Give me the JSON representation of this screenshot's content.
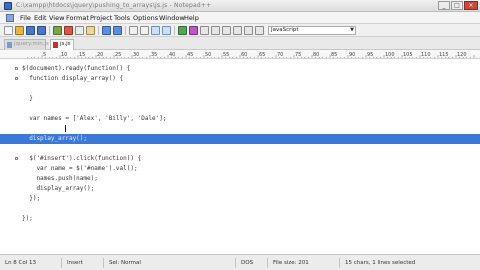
{
  "window": {
    "title": "C:\\xampp\\htdocs\\jquery\\pushing_to_arrays\\js.js - Notepad++"
  },
  "menu": {
    "items": [
      "File",
      "Edit",
      "View",
      "Format",
      "Project",
      "Tools",
      "Options",
      "Window",
      "Help"
    ]
  },
  "toolbar": {
    "language": "JavaScript"
  },
  "tabs": [
    {
      "label": "jquery.min.js",
      "active": false
    },
    {
      "label": "js.js",
      "active": true
    }
  ],
  "ruler": {
    "numbers": [
      "5",
      "10",
      "15",
      "20",
      "25",
      "30",
      "35",
      "40",
      "45",
      "50",
      "55",
      "60",
      "65",
      "70",
      "75",
      "80",
      "85",
      "90",
      "95",
      "100",
      "105",
      "110",
      "115",
      "120"
    ]
  },
  "editor": {
    "lines": [
      "$(document).ready(function() {",
      "  function display_array() {",
      "",
      "  }",
      "",
      "  var names = ['Alex', 'Billy', 'Dale'];",
      "",
      "  display_array();",
      "",
      "  $('#insert').click(function() {",
      "    var name = $('#name').val();",
      "    names.push(name);",
      "    display_array();",
      "  });",
      "",
      "});"
    ],
    "selected_line": 7
  },
  "status": {
    "position": "Ln 8 Col 13",
    "insert": "Insert",
    "mode": "Sel: Normal",
    "eol": "DOS",
    "file_size": "File size: 201",
    "selection": "15 chars, 1 lines selected"
  },
  "colors": {
    "selection": "#3b78d8",
    "accent": "#c9302c"
  }
}
